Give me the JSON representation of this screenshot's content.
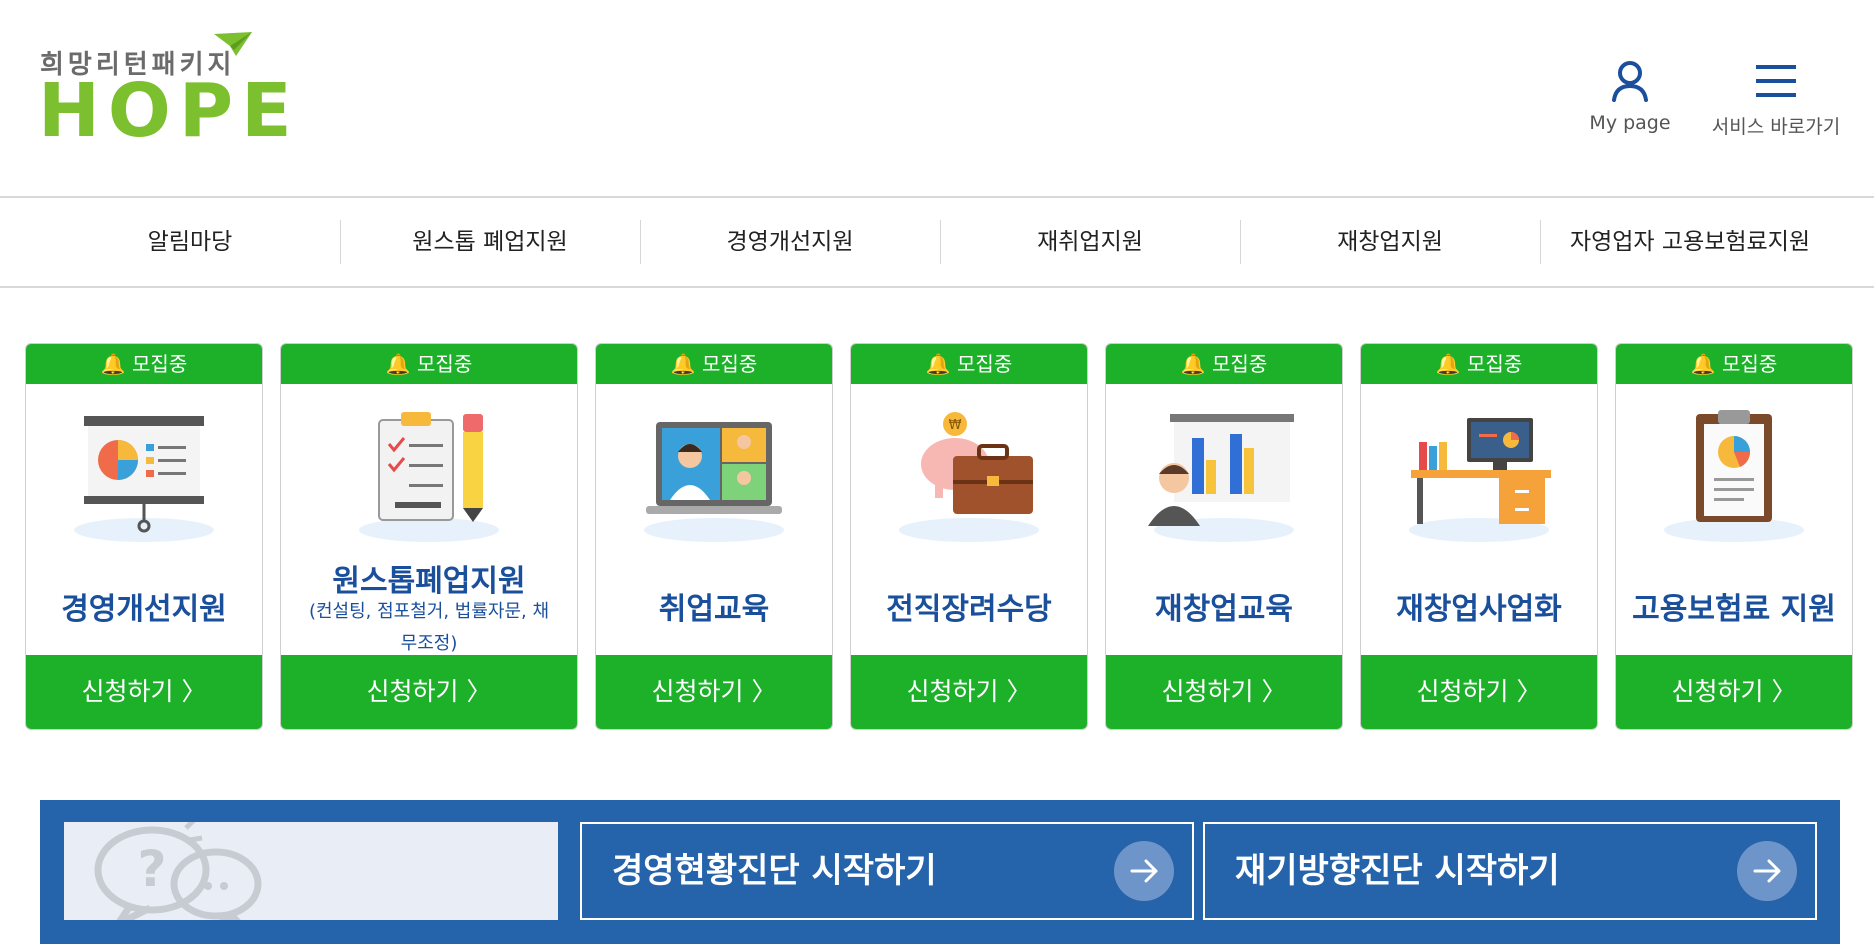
{
  "header": {
    "logo_sub": "희망리턴패키지",
    "logo_main": "HOPE",
    "mypage_label": "My page",
    "service_label": "서비스 바로가기"
  },
  "nav": {
    "items": [
      "알림마당",
      "원스톱 폐업지원",
      "경영개선지원",
      "재취업지원",
      "재창업지원",
      "자영업자 고용보험료지원"
    ]
  },
  "cards": [
    {
      "badge": "모집중",
      "title": "경영개선지원",
      "desc": "",
      "apply": "신청하기 〉",
      "icon": "presentation-board-icon"
    },
    {
      "badge": "모집중",
      "title": "원스톱폐업지원",
      "desc": "(컨설팅, 점포철거, 법률자문, 채무조정)",
      "apply": "신청하기 〉",
      "icon": "checklist-pencil-icon"
    },
    {
      "badge": "모집중",
      "title": "취업교육",
      "desc": "",
      "apply": "신청하기 〉",
      "icon": "video-conference-laptop-icon"
    },
    {
      "badge": "모집중",
      "title": "전직장려수당",
      "desc": "",
      "apply": "신청하기 〉",
      "icon": "piggy-bank-briefcase-icon"
    },
    {
      "badge": "모집중",
      "title": "재창업교육",
      "desc": "",
      "apply": "신청하기 〉",
      "icon": "bar-chart-presenter-icon"
    },
    {
      "badge": "모집중",
      "title": "재창업사업화",
      "desc": "",
      "apply": "신청하기 〉",
      "icon": "office-desk-computer-icon"
    },
    {
      "badge": "모집중",
      "title": "고용보험료 지원",
      "desc": "",
      "apply": "신청하기 〉",
      "icon": "clipboard-pie-chart-icon"
    }
  ],
  "banner": {
    "diag1": "경영현황진단 시작하기",
    "diag2": "재기방향진단 시작하기"
  },
  "colors": {
    "green": "#1db12a",
    "blue": "#2563ab",
    "title_blue": "#1a4f9c",
    "logo_green": "#7cbf2f"
  }
}
